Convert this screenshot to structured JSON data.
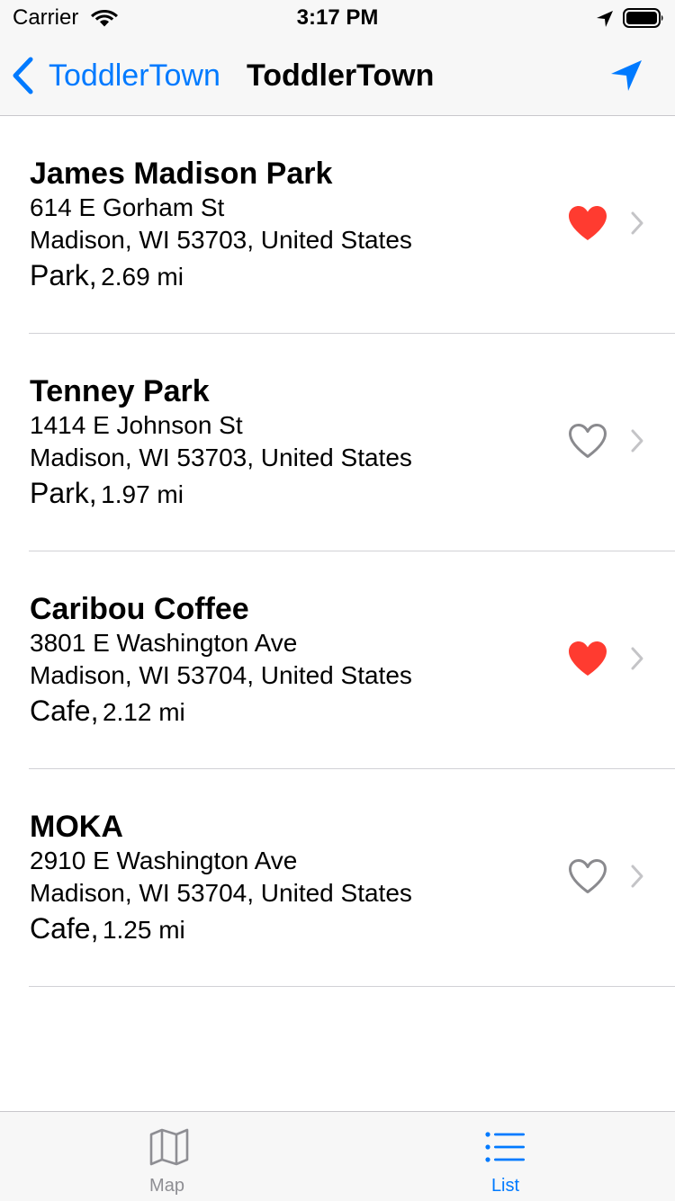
{
  "status_bar": {
    "carrier": "Carrier",
    "time": "3:17 PM"
  },
  "nav": {
    "back_label": "ToddlerTown",
    "title": "ToddlerTown"
  },
  "colors": {
    "accent": "#007aff",
    "favorite": "#ff3b30",
    "secondary": "#8e8e93",
    "bar_background": "#f7f7f7"
  },
  "places": [
    {
      "name": "James Madison Park",
      "street": "614 E Gorham St",
      "city": "Madison, WI  53703, United States",
      "type": "Park,",
      "distance": "2.69 mi",
      "favorite": true
    },
    {
      "name": "Tenney Park",
      "street": "1414 E Johnson St",
      "city": "Madison, WI  53703, United States",
      "type": "Park,",
      "distance": "1.97 mi",
      "favorite": false
    },
    {
      "name": "Caribou Coffee",
      "street": "3801 E Washington Ave",
      "city": "Madison, WI  53704, United States",
      "type": "Cafe,",
      "distance": "2.12 mi",
      "favorite": true
    },
    {
      "name": "MOKA",
      "street": "2910 E Washington Ave",
      "city": "Madison, WI  53704, United States",
      "type": "Cafe,",
      "distance": "1.25 mi",
      "favorite": false
    }
  ],
  "tabs": [
    {
      "label": "Map",
      "icon": "map-icon",
      "selected": false
    },
    {
      "label": "List",
      "icon": "list-icon",
      "selected": true
    }
  ]
}
